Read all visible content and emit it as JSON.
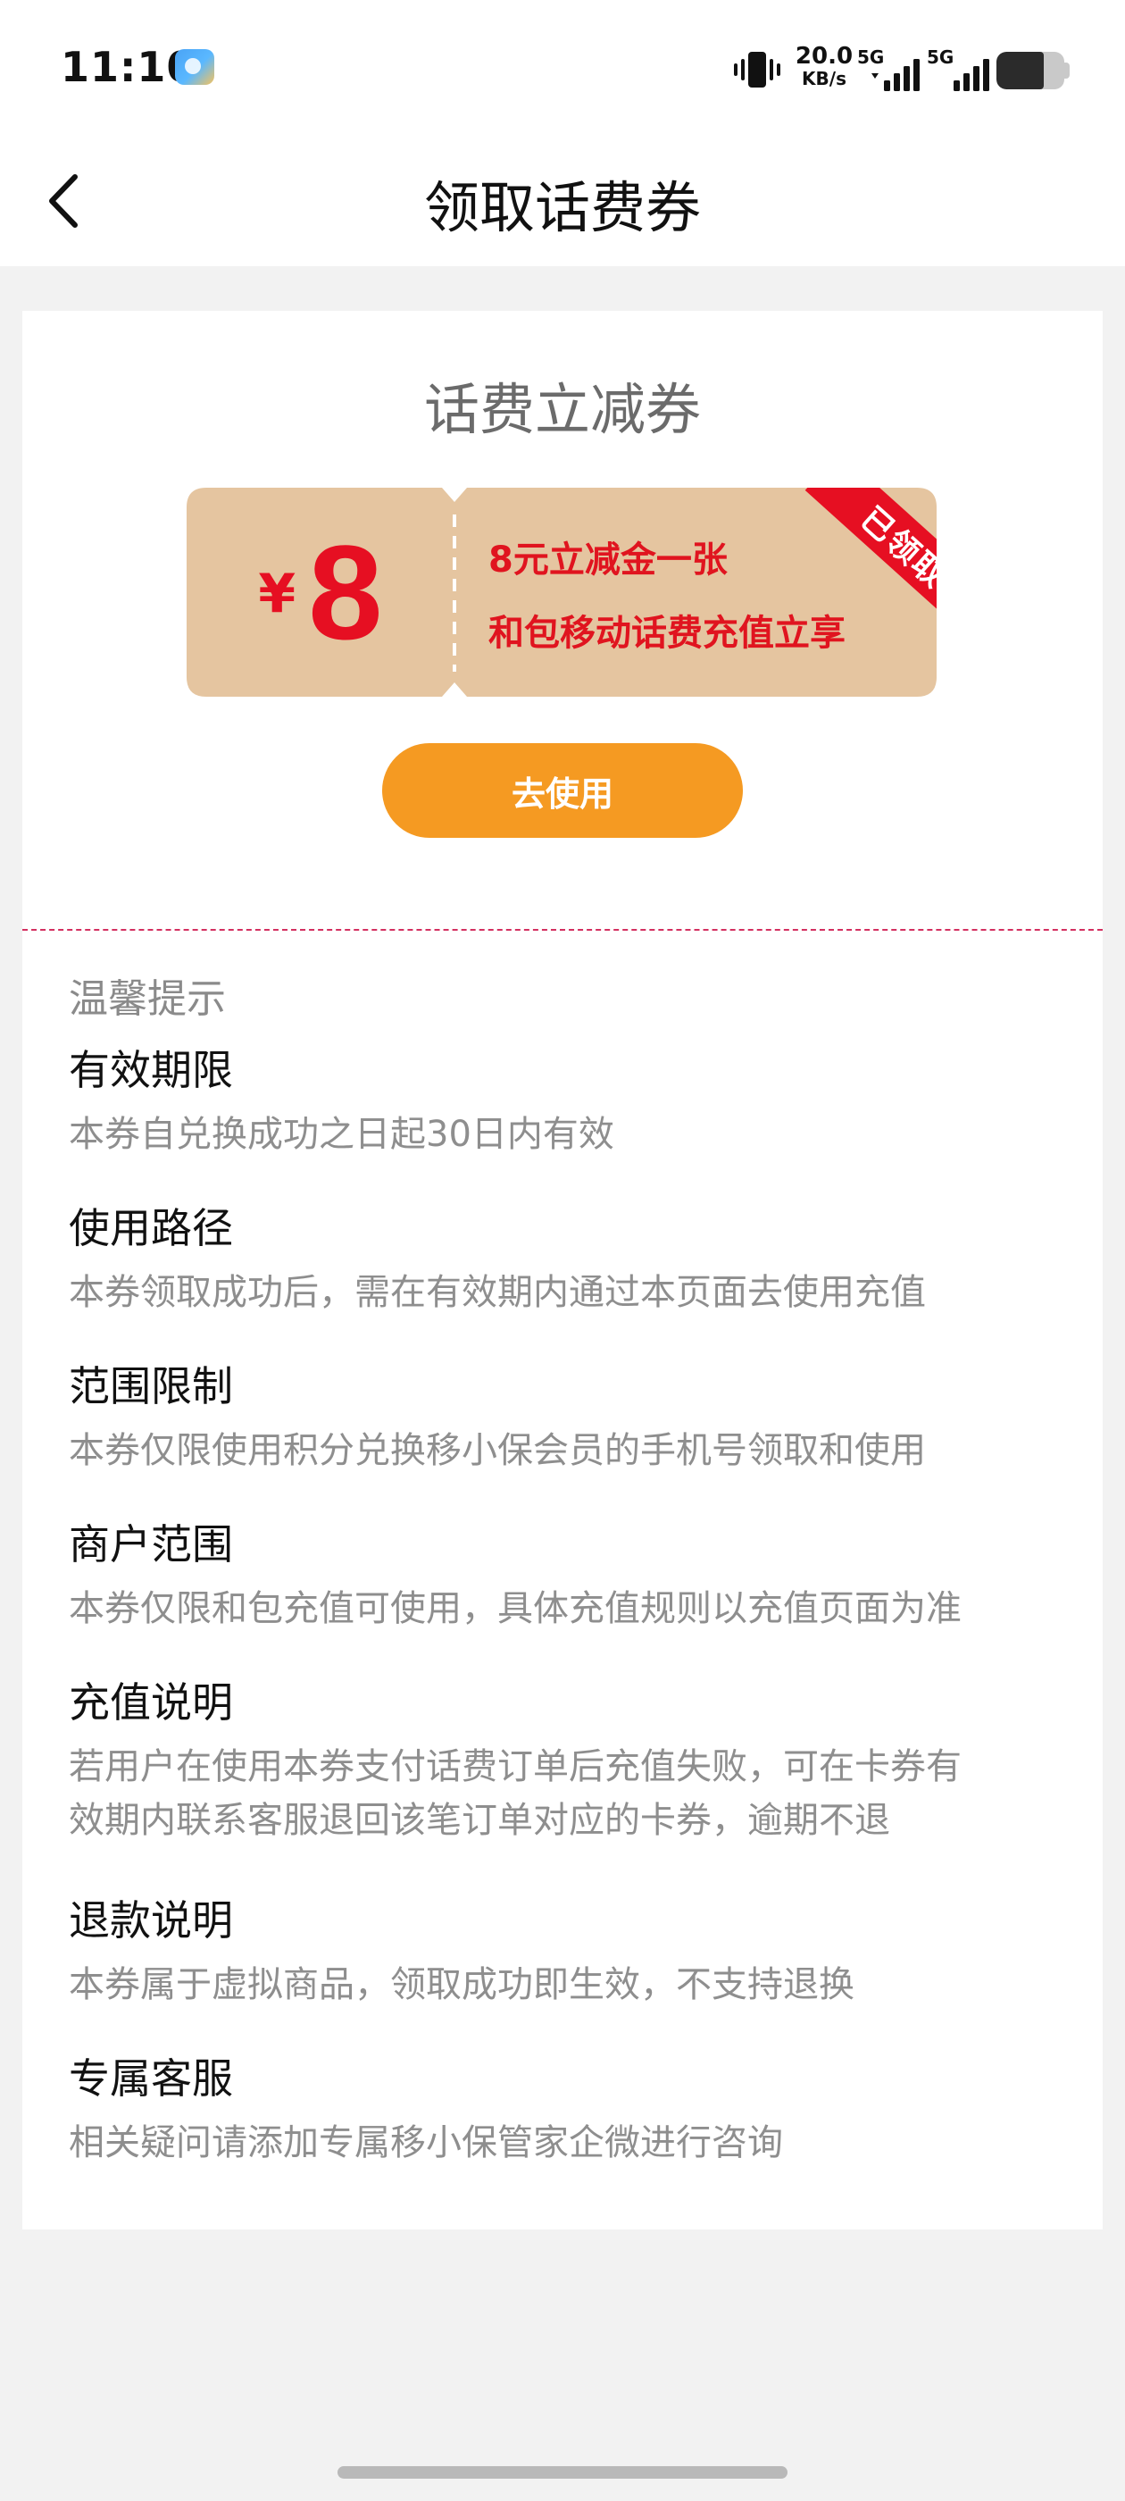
{
  "status_bar": {
    "time": "11:10",
    "net_speed_value": "20.0",
    "net_speed_unit": "KB/s",
    "signal_1_label": "5G",
    "signal_2_label": "5G",
    "battery_level": 0.7,
    "icons": [
      "app-notification-icon",
      "vibrate-icon",
      "signal-icon",
      "battery-icon"
    ]
  },
  "nav": {
    "back_icon": "chevron-left-icon",
    "title": "领取话费券"
  },
  "coupon_card": {
    "title": "话费立减券",
    "currency": "¥",
    "amount": "8",
    "desc_line_1": "8元立减金一张",
    "desc_line_2": "和包移动话费充值立享",
    "claimed_label": "已领取",
    "use_button_label": "去使用"
  },
  "tips": {
    "heading": "温馨提示",
    "sections": [
      {
        "title": "有效期限",
        "lines": [
          "本券自兑换成功之日起30日内有效"
        ]
      },
      {
        "title": "使用路径",
        "lines": [
          "本券领取成功后，需在有效期内通过本页面去使用充值"
        ]
      },
      {
        "title": "范围限制",
        "lines": [
          "本券仅限使用积分兑换移小保会员的手机号领取和使用"
        ]
      },
      {
        "title": "商户范围",
        "lines": [
          "本券仅限和包充值可使用，具体充值规则以充值页面为准"
        ]
      },
      {
        "title": "充值说明",
        "lines": [
          "若用户在使用本券支付话费订单后充值失败，可在卡券有",
          "效期内联系客服退回该笔订单对应的卡券，逾期不退"
        ]
      },
      {
        "title": "退款说明",
        "lines": [
          "本券属于虚拟商品，领取成功即生效，不支持退换"
        ]
      },
      {
        "title": "专属客服",
        "lines": [
          "相关疑问请添加专属移小保管家企微进行咨询"
        ]
      }
    ]
  },
  "colors": {
    "page_bg": "#f2f2f2",
    "coupon_bg": "#e5c5a0",
    "coupon_text": "#e60f22",
    "button_bg": "#f59a22",
    "divider": "#d43060"
  }
}
